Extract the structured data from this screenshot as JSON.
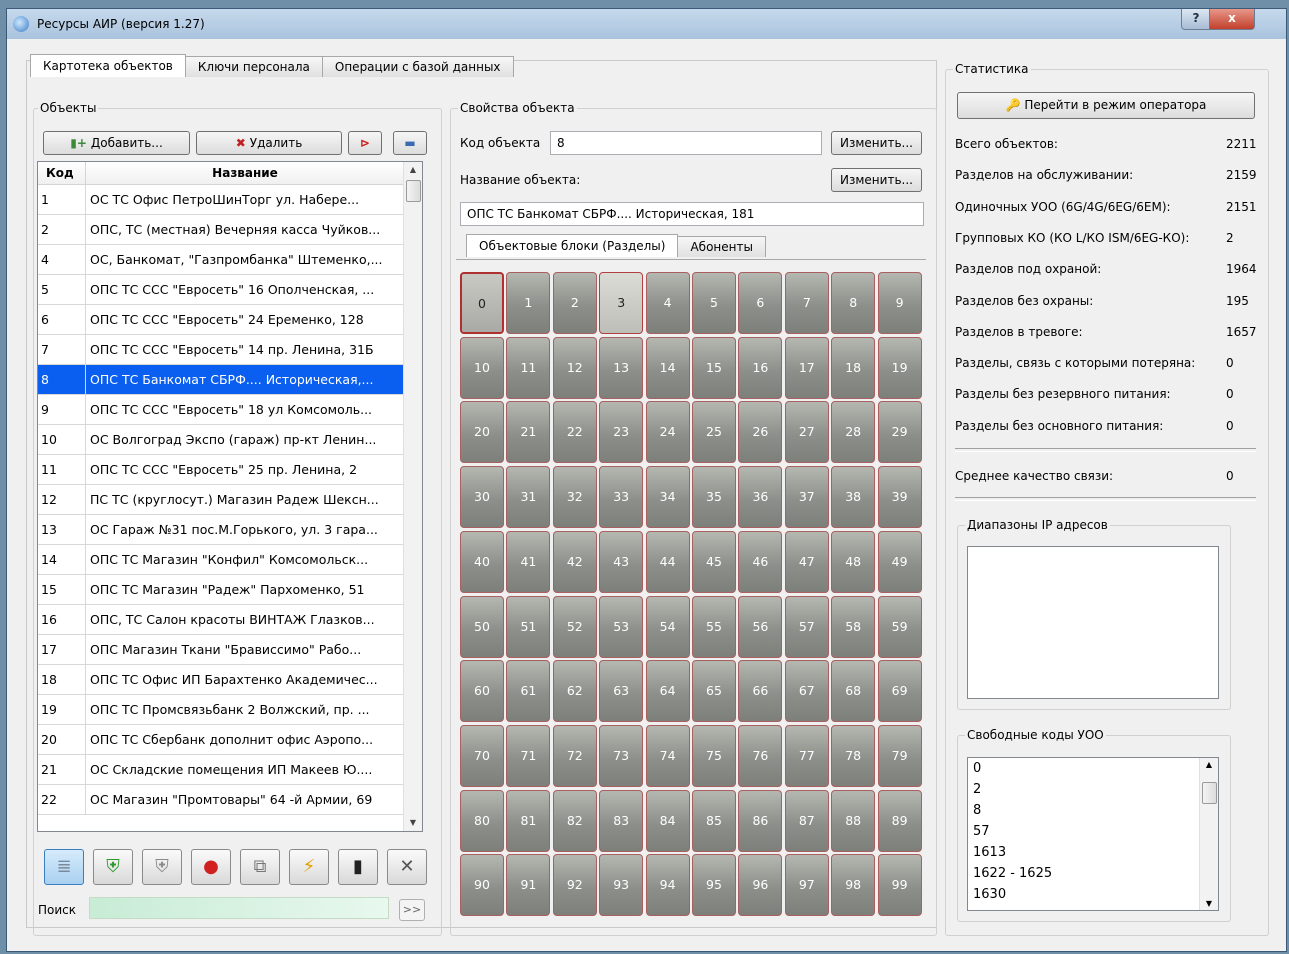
{
  "window": {
    "title": "Ресурсы АИР (версия 1.27)",
    "help_label": "?",
    "close_label": "x"
  },
  "tabs": [
    "Картотека объектов",
    "Ключи персонала",
    "Операции с базой данных"
  ],
  "objects": {
    "group_label": "Объекты",
    "add_label": "Добавить...",
    "delete_label": "Удалить",
    "columns": {
      "code": "Код",
      "name": "Название"
    },
    "rows": [
      {
        "code": "1",
        "name": "ОС ТС   Офис ПетроШинТорг ул. Набере..."
      },
      {
        "code": "2",
        "name": "ОПС, ТС (местная) Вечерняя касса Чуйков..."
      },
      {
        "code": "4",
        "name": "ОС, Банкомат, \"Газпромбанка\" Штеменко,..."
      },
      {
        "code": "5",
        "name": "ОПС ТС ССС \"Евросеть\" 16 Ополченская, ..."
      },
      {
        "code": "6",
        "name": "ОПС ТС ССС \"Евросеть\" 24 Еременко, 128"
      },
      {
        "code": "7",
        "name": "ОПС ТС ССС \"Евросеть\" 14 пр. Ленина, 31Б"
      },
      {
        "code": "8",
        "name": "ОПС ТС  Банкомат СБРФ.... Историческая,..."
      },
      {
        "code": "9",
        "name": "ОПС ТС ССС \"Евросеть\" 18 ул Комсомоль..."
      },
      {
        "code": "10",
        "name": "ОС Волгоград Экспо (гараж) пр-кт Ленин..."
      },
      {
        "code": "11",
        "name": "ОПС ТС ССС \"Евросеть\" 25 пр. Ленина, 2"
      },
      {
        "code": "12",
        "name": "ПС ТС (круглосут.) Магазин Радеж Шексн..."
      },
      {
        "code": "13",
        "name": "ОС Гараж №31 пос.М.Горького, ул. 3 гара..."
      },
      {
        "code": "14",
        "name": "ОПС ТС  Магазин \"Конфил\" Комсомольск..."
      },
      {
        "code": "15",
        "name": "ОПС ТС Магазин \"Радеж\" Пархоменко, 51"
      },
      {
        "code": "16",
        "name": "ОПС, ТС Салон красоты ВИНТАЖ Глазков..."
      },
      {
        "code": "17",
        "name": "ОПС  Магазин  Ткани \"Брависсимо\" Рабо..."
      },
      {
        "code": "18",
        "name": "ОПС ТС Офис ИП Барахтенко Академичес..."
      },
      {
        "code": "19",
        "name": "ОПС ТС Промсвязьбанк 2 Волжский, пр. ..."
      },
      {
        "code": "20",
        "name": "ОПС ТС Сбербанк дополнит офис Аэропо..."
      },
      {
        "code": "21",
        "name": "ОС Складские помещения ИП Макеев Ю...."
      },
      {
        "code": "22",
        "name": "ОС Магазин \"Промтовары\" 64 -й Армии, 69"
      }
    ],
    "selected_code": "8",
    "search_label": "Поиск",
    "search_value": "",
    "search_go": ">>"
  },
  "properties": {
    "group_label": "Свойства объекта",
    "code_label": "Код объекта",
    "code_value": "8",
    "change_label": "Изменить...",
    "name_label": "Название объекта:",
    "name_value": "ОПС ТС  Банкомат СБРФ.... Историческая, 181",
    "subtabs": [
      "Объектовые блоки (Разделы)",
      "Абоненты"
    ]
  },
  "stats": {
    "group_label": "Статистика",
    "operator_label": "Перейти в режим оператора",
    "items": [
      {
        "label": "Всего объектов:",
        "value": "2211"
      },
      {
        "label": "Разделов на обслуживании:",
        "value": "2159"
      },
      {
        "label": "Одиночных УОО (6G/4G/6EG/6EM):",
        "value": "2151"
      },
      {
        "label": "Групповых КО (КО L/КО ISM/6EG-КО):",
        "value": "2"
      },
      {
        "label": "Разделов под охраной:",
        "value": "1964"
      },
      {
        "label": "Разделов без охраны:",
        "value": "195"
      },
      {
        "label": "Разделов в тревоге:",
        "value": "1657"
      },
      {
        "label": "Разделы, связь с которыми потеряна:",
        "value": "0"
      },
      {
        "label": "Разделы без резервного питания:",
        "value": "0"
      },
      {
        "label": "Разделы без основного питания:",
        "value": "0"
      }
    ],
    "quality_label": "Среднее качество связи:",
    "quality_value": "0",
    "ip_label": "Диапазоны IP адресов",
    "free_label": "Свободные коды УОО",
    "free_codes": [
      "0",
      "2",
      "8",
      "57",
      "1613",
      "1622 - 1625",
      "1630"
    ]
  }
}
